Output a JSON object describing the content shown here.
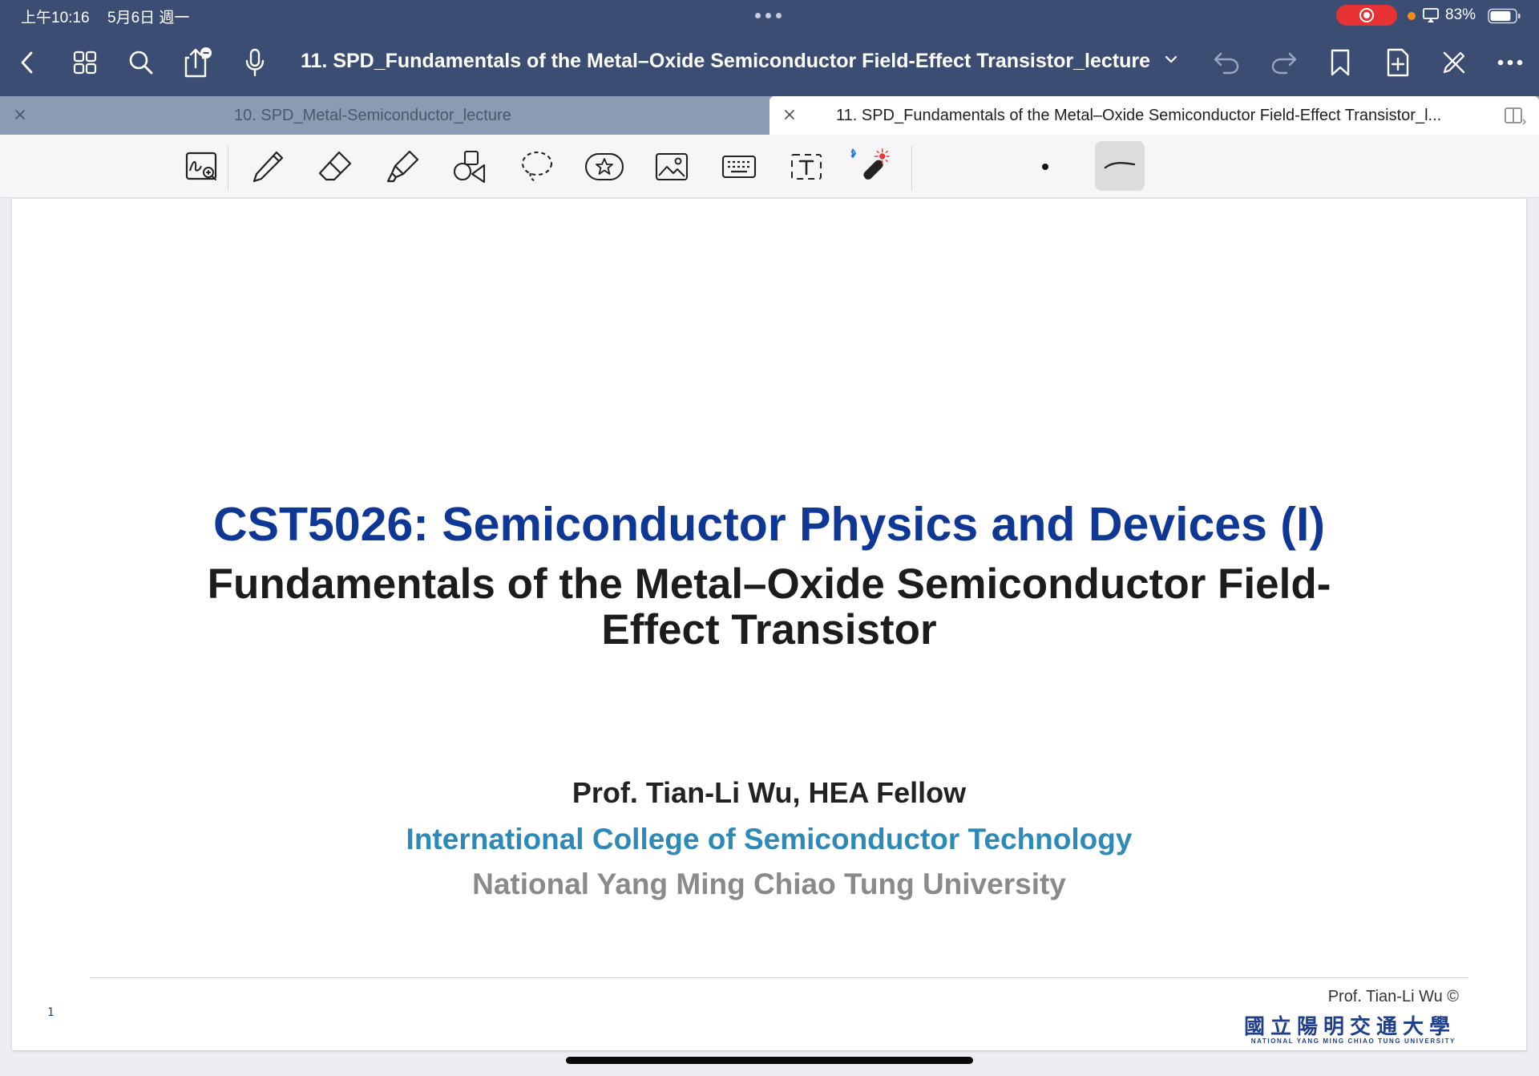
{
  "status_bar": {
    "time": "上午10:16",
    "date": "5月6日 週一",
    "battery_percent": "83%",
    "recording": true,
    "battery_level": 0.83
  },
  "nav": {
    "back_icon": "chevron-left-icon",
    "document_title": "11. SPD_Fundamentals of the Metal–Oxide Semiconductor Field-Effect Transistor_lecture"
  },
  "tabs": [
    {
      "label": "10. SPD_Metal-Semiconductor_lecture",
      "active": false
    },
    {
      "label": "11. SPD_Fundamentals of the Metal–Oxide Semiconductor Field-Effect Transistor_l...",
      "active": true
    }
  ],
  "toolbar": {
    "tools": [
      "zoom-window",
      "pen",
      "eraser",
      "highlighter",
      "shapes",
      "lasso",
      "elements",
      "image",
      "keyboard",
      "text-box",
      "laser-pointer"
    ],
    "selected_tool": "stroke-style"
  },
  "slide": {
    "title": "CST5026: Semiconductor Physics and Devices (I)",
    "subtitle_line1": "Fundamentals of the Metal–Oxide Semiconductor Field-",
    "subtitle_line2": "Effect Transistor",
    "author": "Prof. Tian-Li Wu, HEA Fellow",
    "college": "International College of Semiconductor Technology",
    "university": "National Yang Ming Chiao Tung University",
    "page_number": "1",
    "footer_credit": "Prof. Tian-Li Wu ©",
    "logo_cn": "國立陽明交通大學",
    "logo_en": "NATIONAL YANG MING CHIAO TUNG UNIVERSITY"
  },
  "colors": {
    "chrome": "#3c4d74",
    "title_blue": "#0f3795",
    "college_blue": "#2d8ab8",
    "university_gray": "#8a8a8a",
    "record_red": "#e63232"
  }
}
